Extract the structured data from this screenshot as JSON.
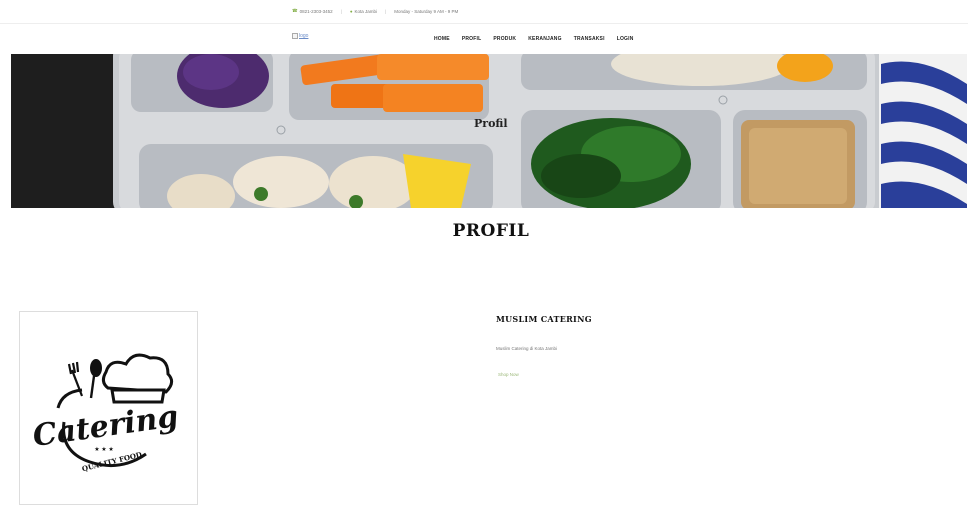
{
  "topbar": {
    "phone": "0821-2303-3452",
    "location": "Kota Jambi",
    "hours": "Monday - Saturday 9 AM - 9 PM"
  },
  "navbar": {
    "logo_alt": "logo",
    "menu": [
      "HOME",
      "PROFIL",
      "PRODUK",
      "KERANJANG",
      "TRANSAKSI",
      "LOGIN"
    ]
  },
  "hero": {
    "title": "Profil"
  },
  "page": {
    "heading": "PROFIL"
  },
  "product": {
    "logo_text": "Catering",
    "logo_subtext": "QUALITY FOOD",
    "name": "MUSLIM CATERING",
    "description": "Muslim Catering di Kota Jambi",
    "shop_label": "Shop Now"
  },
  "colors": {
    "accent": "#82ae46"
  }
}
